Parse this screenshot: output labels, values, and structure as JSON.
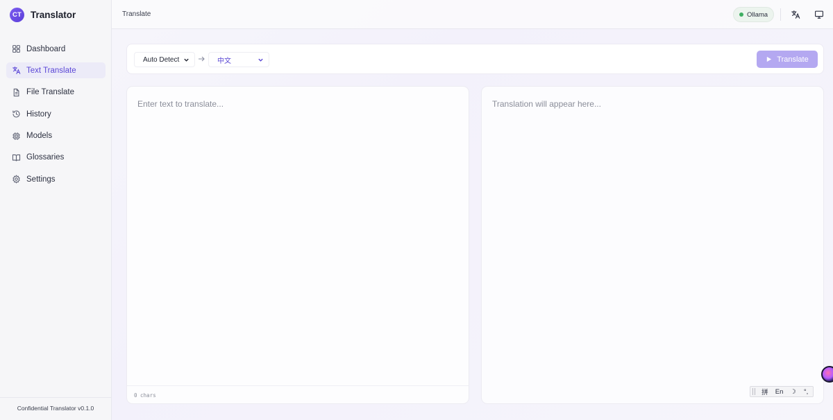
{
  "app": {
    "logo_text": "CT",
    "name": "Translator",
    "version": "Confidential Translator v0.1.0"
  },
  "sidebar": {
    "items": [
      {
        "label": "Dashboard",
        "icon": "grid-icon",
        "active": false
      },
      {
        "label": "Text Translate",
        "icon": "translate-icon",
        "active": true
      },
      {
        "label": "File Translate",
        "icon": "file-icon",
        "active": false
      },
      {
        "label": "History",
        "icon": "history-icon",
        "active": false
      },
      {
        "label": "Models",
        "icon": "cpu-icon",
        "active": false
      },
      {
        "label": "Glossaries",
        "icon": "book-icon",
        "active": false
      },
      {
        "label": "Settings",
        "icon": "gear-icon",
        "active": false
      }
    ]
  },
  "topbar": {
    "breadcrumb": "Translate",
    "status_label": "Ollama",
    "status_color": "#3fae62",
    "icons": [
      "language-icon",
      "monitor-icon"
    ]
  },
  "toolbar": {
    "source_language": "Auto Detect",
    "target_language": "中文",
    "translate_label": "Translate",
    "accent": "#b4a8f1"
  },
  "source_panel": {
    "placeholder": "Enter text to translate...",
    "char_count": "0 chars"
  },
  "target_panel": {
    "placeholder": "Translation will appear here..."
  },
  "ime": {
    "items": [
      "拼",
      "En",
      "☽",
      "°,"
    ]
  }
}
